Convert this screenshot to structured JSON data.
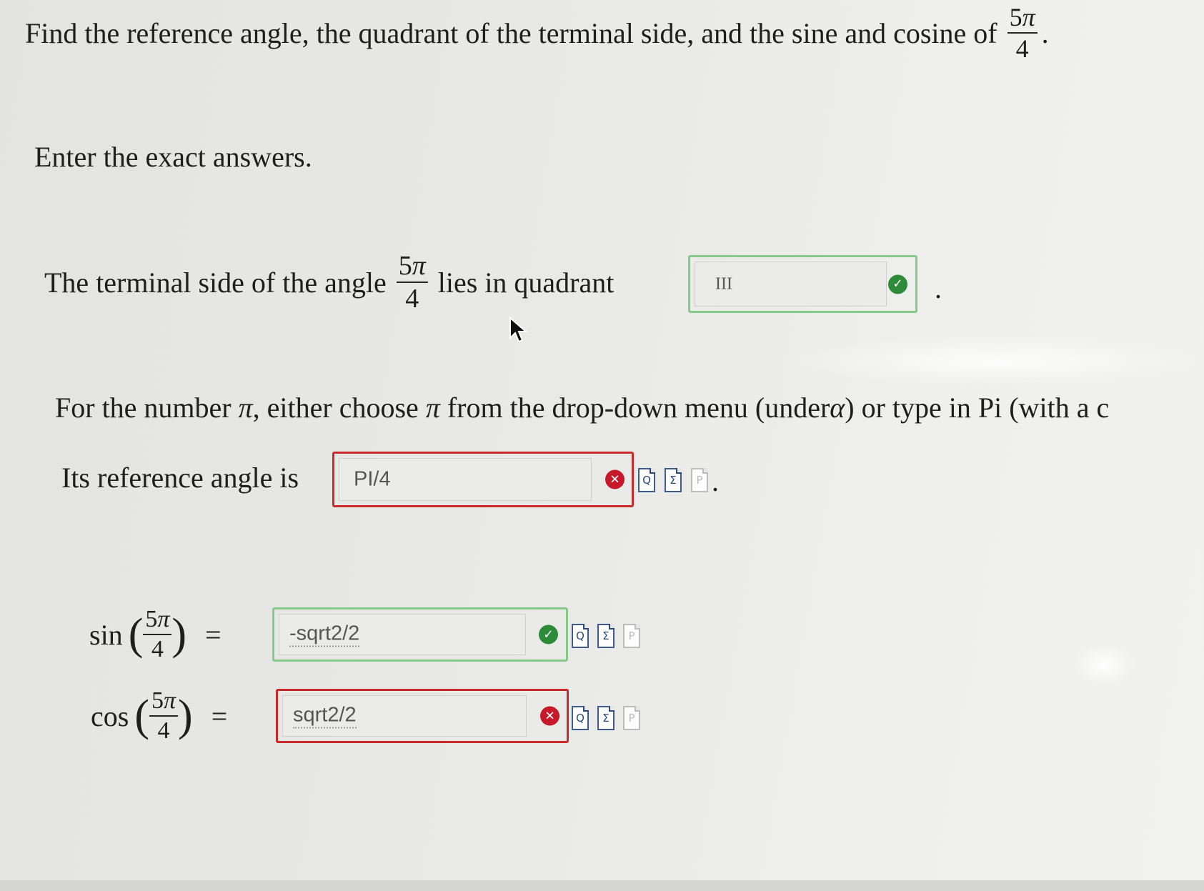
{
  "question": {
    "text": "Find the reference angle, the quadrant of the terminal side, and the sine and cosine of",
    "angle": {
      "numerator": "5",
      "pi": "π",
      "denominator": "4"
    },
    "end": "."
  },
  "instructions": "Enter the exact answers.",
  "quadrant_row": {
    "before": "The terminal side of the angle",
    "after": "lies in quadrant",
    "answer": "III",
    "status": "correct",
    "end": "."
  },
  "hint": {
    "p1": "For the number",
    "p2": ", either choose",
    "p3": "from the drop-down menu (under",
    "alpha": "α",
    "p4": ") or type in Pi (with a c"
  },
  "reference_row": {
    "label": "Its reference angle is",
    "answer": "PI/4",
    "status": "incorrect",
    "end": "."
  },
  "sin_row": {
    "func": "sin",
    "equals": "=",
    "answer": "-sqrt2/2",
    "status": "correct"
  },
  "cos_row": {
    "func": "cos",
    "equals": "=",
    "answer": "sqrt2/2",
    "status": "incorrect"
  },
  "icons": {
    "correct": "check-circle-icon",
    "incorrect": "x-circle-icon",
    "preview": "preview-answer-icon",
    "equation": "equation-editor-icon",
    "file": "file-icon"
  },
  "colors": {
    "correct": "#2e8b3a",
    "incorrect": "#c8192a",
    "correct_border": "#86c98a",
    "incorrect_border": "#c92a2a"
  }
}
